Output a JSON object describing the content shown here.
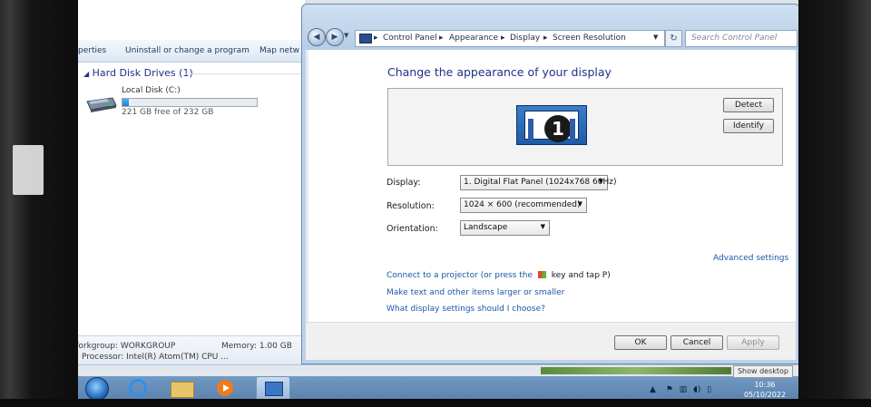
{
  "explorer": {
    "toolbar": {
      "properties": "perties",
      "uninstall": "Uninstall or change a program",
      "map": "Map netw"
    },
    "section_title": "Hard Disk Drives (1)",
    "disk": {
      "name": "Local Disk (C:)",
      "free_text": "221 GB free of 232 GB",
      "used_fraction": 0.047
    },
    "details": {
      "workgroup": "Workgroup: WORKGROUP",
      "memory": "Memory: 1.00 GB",
      "processor": "Processor: Intel(R) Atom(TM) CPU ..."
    }
  },
  "breadcrumb": [
    "Control Panel",
    "Appearance",
    "Display",
    "Screen Resolution"
  ],
  "search": {
    "placeholder": "Search Control Panel"
  },
  "dialog": {
    "title": "Change the appearance of your display",
    "monitor_number": "1",
    "detect": "Detect",
    "identify": "Identify",
    "display_label": "Display:",
    "display_value": "1. Digital Flat Panel (1024x768 60Hz)",
    "resolution_label": "Resolution:",
    "resolution_value": "1024 × 600 (recommended)",
    "orientation_label": "Orientation:",
    "orientation_value": "Landscape",
    "advanced": "Advanced settings",
    "link_projector": "Connect to a projector (or press the",
    "link_projector_tail": "key and tap P)",
    "link_text_size": "Make text and other items larger or smaller",
    "link_which": "What display settings should I choose?",
    "ok": "OK",
    "cancel": "Cancel",
    "apply": "Apply"
  },
  "taskbar": {
    "show_desktop": "Show desktop",
    "time": "10:36",
    "date": "05/10/2022",
    "apps": [
      "start",
      "internet-explorer",
      "windows-explorer",
      "media-player",
      "control-panel"
    ]
  },
  "colors": {
    "link": "#1c56a8",
    "title": "#1e3287",
    "taskbar": "#6e95bf"
  }
}
